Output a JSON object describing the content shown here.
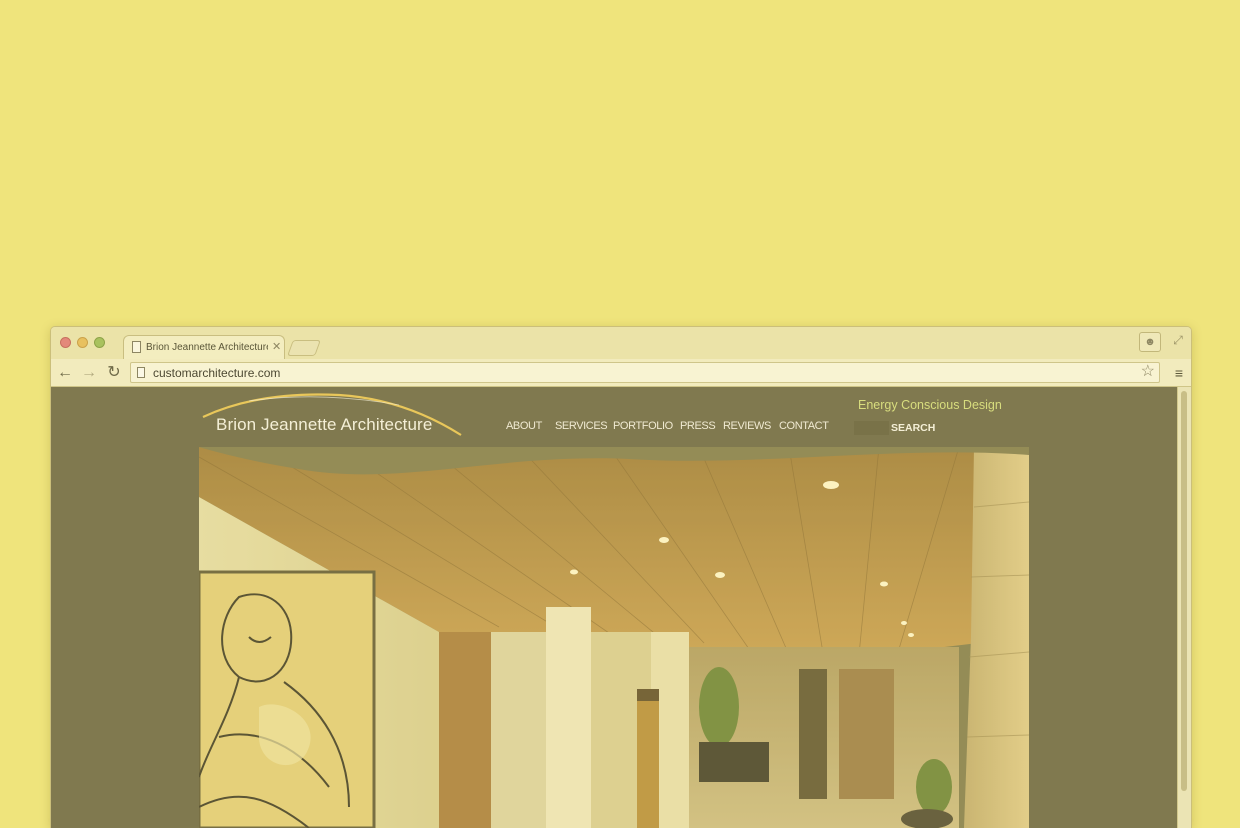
{
  "browser": {
    "tab": {
      "title": "Brion Jeannette Architecture"
    },
    "address_bar": {
      "url": "customarchitecture.com"
    }
  },
  "site": {
    "logo_text": "Brion Jeannette Architecture",
    "nav": [
      {
        "label": "ABOUT"
      },
      {
        "label": "SERVICES"
      },
      {
        "label": "PORTFOLIO"
      },
      {
        "label": "PRESS"
      },
      {
        "label": "REVIEWS"
      },
      {
        "label": "CONTACT"
      }
    ],
    "tagline": "Energy Conscious Design",
    "search_label": "SEARCH"
  },
  "colors": {
    "page_background": "#efe47c",
    "site_background": "#80794f",
    "accent_arc": "#e9c75a",
    "tagline": "#d8dd7e"
  },
  "icons": [
    "page-icon",
    "close-icon",
    "back-arrow-icon",
    "forward-arrow-icon",
    "reload-icon",
    "star-icon",
    "menu-icon",
    "profile-icon",
    "fullscreen-icon"
  ]
}
